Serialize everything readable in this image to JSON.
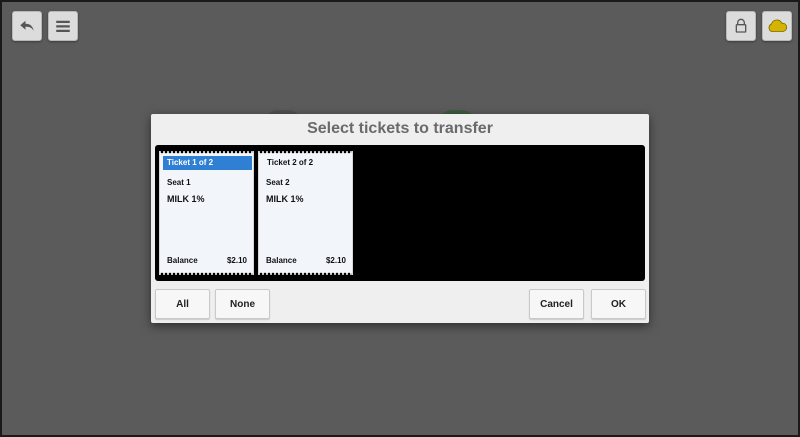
{
  "toolbar": {
    "back_icon": "back-arrow-icon",
    "menu_icon": "hamburger-menu-icon",
    "lock_icon": "lock-icon",
    "cloud_icon": "cloud-icon",
    "cloud_color": "#d4b400"
  },
  "dialog": {
    "title": "Select tickets to transfer",
    "tickets": [
      {
        "header": "Ticket 1 of 2",
        "selected": true,
        "seat": "Seat 1",
        "item": "MILK 1%",
        "balance_label": "Balance",
        "balance_value": "$2.10"
      },
      {
        "header": "Ticket 2 of 2",
        "selected": false,
        "seat": "Seat 2",
        "item": "MILK 1%",
        "balance_label": "Balance",
        "balance_value": "$2.10"
      }
    ],
    "buttons": {
      "all": "All",
      "none": "None",
      "cancel": "Cancel",
      "ok": "OK"
    },
    "selected_color": "#2f7fd4"
  }
}
